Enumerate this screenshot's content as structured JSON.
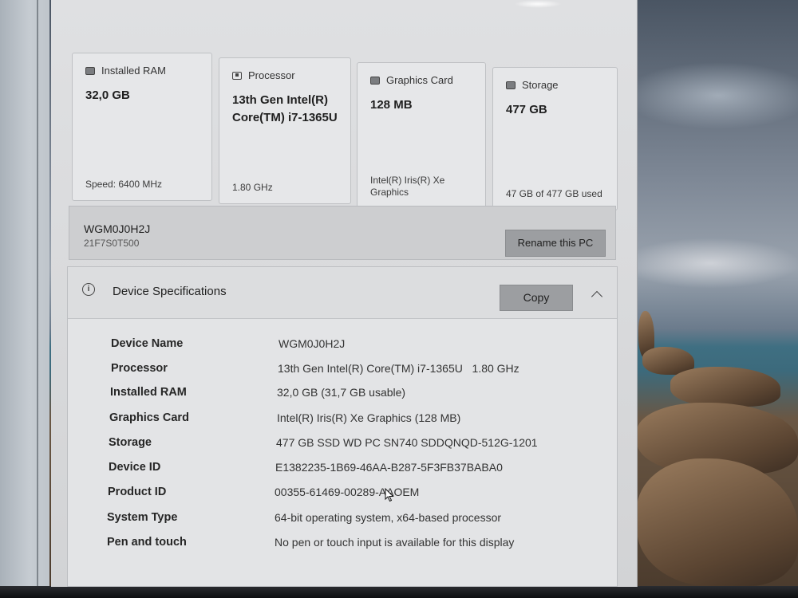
{
  "cards": [
    {
      "id": "ram",
      "icon": "memory-icon",
      "title": "Installed RAM",
      "value": "32,0 GB",
      "foot": "Speed: 6400 MHz"
    },
    {
      "id": "cpu",
      "icon": "processor-icon",
      "title": "Processor",
      "value": "13th Gen Intel(R) Core(TM) i7-1365U",
      "foot": "1.80 GHz"
    },
    {
      "id": "gpu",
      "icon": "graphics-card-icon",
      "title": "Graphics Card",
      "value": "128 MB",
      "foot": "Intel(R) Iris(R) Xe Graphics"
    },
    {
      "id": "storage",
      "icon": "storage-icon",
      "title": "Storage",
      "value": "477 GB",
      "foot": "47 GB of 477 GB used"
    }
  ],
  "pc": {
    "name": "WGM0J0H2J",
    "model": "21F7S0T500",
    "rename_label": "Rename this PC"
  },
  "specs": {
    "title": "Device Specifications",
    "copy_label": "Copy",
    "rows": [
      {
        "label": "Device Name",
        "value": "WGM0J0H2J"
      },
      {
        "label": "Processor",
        "value": "13th Gen Intel(R) Core(TM) i7-1365U   1.80 GHz"
      },
      {
        "label": "Installed RAM",
        "value": "32,0 GB (31,7 GB usable)"
      },
      {
        "label": "Graphics Card",
        "value": "Intel(R) Iris(R) Xe Graphics (128 MB)"
      },
      {
        "label": "Storage",
        "value": "477 GB SSD WD PC SN740 SDDQNQD-512G-1201"
      },
      {
        "label": "Device ID",
        "value": "E1382235-1B69-46AA-B287-5F3FB37BABA0"
      },
      {
        "label": "Product ID",
        "value": "00355-61469-00289-AAOEM"
      },
      {
        "label": "System Type",
        "value": "64-bit operating system, x64-based processor"
      },
      {
        "label": "Pen and touch",
        "value": "No pen or touch input is available for this display"
      }
    ]
  }
}
